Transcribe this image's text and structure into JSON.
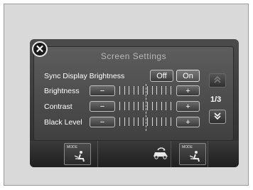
{
  "screen": {
    "title": "Screen Settings",
    "close_icon": "close-icon",
    "rows": [
      {
        "label": "Sync Display Brightness",
        "type": "toggle",
        "options": [
          "Off",
          "On"
        ]
      },
      {
        "label": "Brightness",
        "type": "slider",
        "minus": "−",
        "plus": "+"
      },
      {
        "label": "Contrast",
        "type": "slider",
        "minus": "−",
        "plus": "+"
      },
      {
        "label": "Black Level",
        "type": "slider",
        "minus": "−",
        "plus": "+"
      }
    ],
    "page_indicator": "1/3",
    "scroll_up_icon": "double-chevron-up-icon",
    "scroll_down_icon": "double-chevron-down-icon"
  },
  "bottom_bar": {
    "left_mode_label": "MODE",
    "right_mode_label": "MODE",
    "center_icon": "recirculation-car-icon"
  }
}
